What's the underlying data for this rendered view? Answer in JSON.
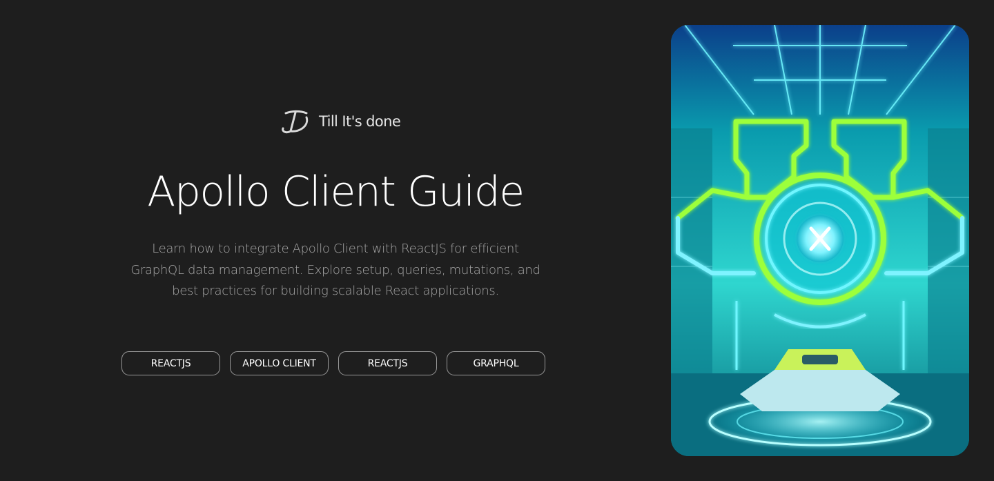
{
  "brand": {
    "name": "Till It's done",
    "logo_icon": "handwritten-td-logo"
  },
  "hero": {
    "title": "Apollo Client Guide",
    "description": "Learn how to integrate Apollo Client with ReactJS for efficient GraphQL data management. Explore setup, queries, mutations, and best practices for building scalable React applications."
  },
  "tags": [
    {
      "label": "REACTJS"
    },
    {
      "label": "APOLLO CLIENT"
    },
    {
      "label": "REACTJS"
    },
    {
      "label": "GRAPHQL"
    }
  ],
  "image": {
    "subject": "neon sci-fi chamber with glowing X emblem and hovering vehicle",
    "colors": {
      "cyan": "#00e5ff",
      "lime": "#9dff3a",
      "teal": "#0a8f9a",
      "deep": "#054a5a"
    }
  },
  "theme": {
    "background": "#1e1e1e",
    "title_color": "#ffffff",
    "text_muted": "#a8a8a8",
    "tag_border": "#9a9a9a"
  }
}
